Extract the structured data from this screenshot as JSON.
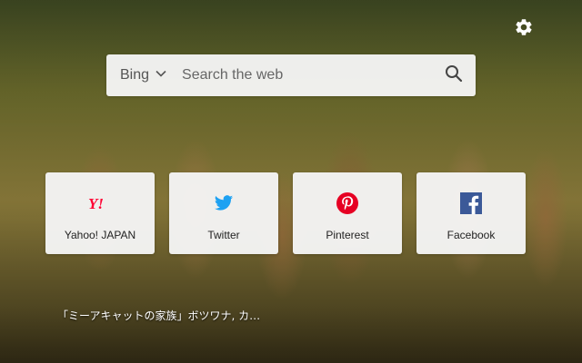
{
  "search": {
    "engine": "Bing",
    "placeholder": "Search the web"
  },
  "tiles": [
    {
      "label": "Yahoo! JAPAN",
      "icon": "yahoo-japan-icon",
      "color": "#ff0033"
    },
    {
      "label": "Twitter",
      "icon": "twitter-icon",
      "color": "#1da1f2"
    },
    {
      "label": "Pinterest",
      "icon": "pinterest-icon",
      "color": "#e60023"
    },
    {
      "label": "Facebook",
      "icon": "facebook-icon",
      "color": "#3b5998"
    }
  ],
  "background": {
    "caption": "「ミーアキャットの家族」ボツワナ, カ…"
  },
  "settings": {
    "icon": "gear-icon"
  }
}
